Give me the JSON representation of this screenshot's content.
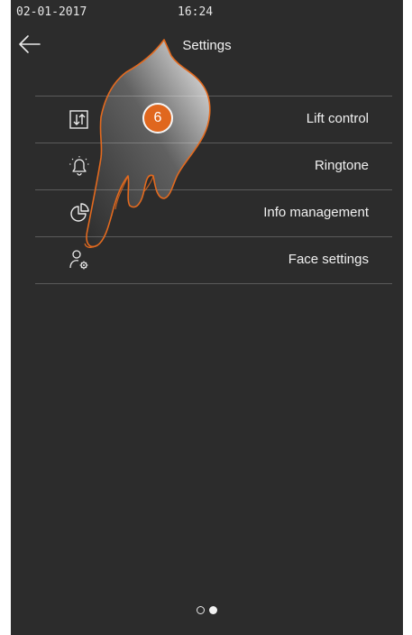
{
  "status_bar": {
    "date": "02-01-2017",
    "time": "16:24"
  },
  "header": {
    "title": "Settings",
    "back_icon": "arrow-left-icon"
  },
  "menu": {
    "items": [
      {
        "label": "Lift control",
        "icon": "lift-arrows-icon"
      },
      {
        "label": "Ringtone",
        "icon": "bell-icon"
      },
      {
        "label": "Info management",
        "icon": "pie-chart-icon"
      },
      {
        "label": "Face settings",
        "icon": "user-gear-icon"
      }
    ]
  },
  "annotation": {
    "step": "6"
  },
  "pager": {
    "pages": 2,
    "current": 2
  },
  "colors": {
    "background": "#2c2c2c",
    "text": "#f0f0f0",
    "accent": "#e0671e",
    "divider": "#5b5b5b"
  }
}
